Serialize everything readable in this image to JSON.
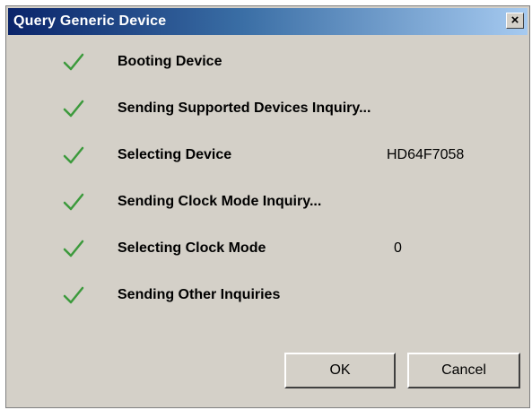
{
  "window": {
    "title": "Query Generic Device",
    "close_glyph": "×"
  },
  "steps": [
    {
      "label": "Booting Device",
      "status": "done",
      "value": ""
    },
    {
      "label": "Sending Supported Devices Inquiry...",
      "status": "done",
      "value": ""
    },
    {
      "label": "Selecting Device",
      "status": "done",
      "value": "HD64F7058"
    },
    {
      "label": "Sending Clock Mode Inquiry...",
      "status": "done",
      "value": ""
    },
    {
      "label": "Selecting Clock Mode",
      "status": "done",
      "value": "0"
    },
    {
      "label": "Sending Other Inquiries",
      "status": "done",
      "value": ""
    }
  ],
  "buttons": {
    "ok_label": "OK",
    "cancel_label": "Cancel"
  },
  "colors": {
    "titlebar_start": "#0a246a",
    "titlebar_end": "#a6caf0",
    "dialog_bg": "#d4d0c8",
    "check_green": "#3c9a3c"
  },
  "icons": {
    "step_status": "checkmark-icon",
    "close": "close-icon"
  }
}
